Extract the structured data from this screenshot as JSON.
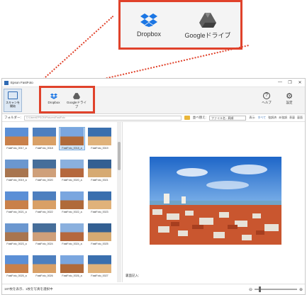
{
  "window": {
    "title": "Epson FastFoto"
  },
  "callout": {
    "dropbox_label": "Dropbox",
    "gdrive_label": "Googleドライブ"
  },
  "ribbon": {
    "scan_label_1": "スキャンを",
    "scan_label_2": "開始",
    "dropbox_label": "Dropbox",
    "gdrive_label": "Googleドライブ",
    "help_label": "ヘルプ",
    "settings_label": "設定"
  },
  "folderbar": {
    "folder_label": "フォルダー:",
    "path": "C:\\Users\\EPSON\\Pictures\\FastFoto",
    "sort_label": "並べ替え:",
    "sort_value": "ファイル名 : 昇順",
    "select_label": "表示:",
    "select_options": [
      "すべて",
      "強調済",
      "未強調",
      "表裏",
      "裏面"
    ]
  },
  "thumbnails": [
    "FastFoto_0017_a",
    "FastFoto_0018",
    "FastFoto_0018_a",
    "FastFoto_0019",
    "FastFoto_0019_a",
    "FastFoto_0020",
    "FastFoto_0020_a",
    "FastFoto_0021",
    "FastFoto_0021_a",
    "FastFoto_0022",
    "FastFoto_0022_a",
    "FastFoto_0023",
    "FastFoto_0023_a",
    "FastFoto_0024",
    "FastFoto_0024_a",
    "FastFoto_0025",
    "FastFoto_0025_a",
    "FastFoto_0026",
    "FastFoto_0026_a",
    "FastFoto_0027"
  ],
  "selected_thumbnail": "FastFoto_0018_a",
  "preview": {
    "note_label": "裏面記入:"
  },
  "status": {
    "text": "187枚を表示、1枚を写真を選択中"
  },
  "colors": {
    "accent": "#e0422b",
    "brand": "#2f6ab3"
  }
}
